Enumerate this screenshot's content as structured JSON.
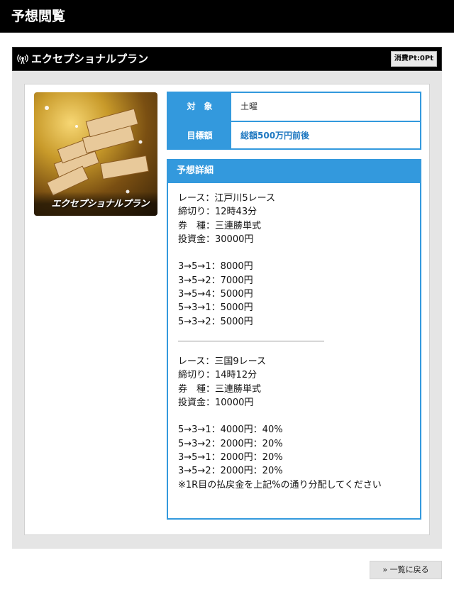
{
  "header": {
    "title": "予想閲覧"
  },
  "plan": {
    "title": "エクセプショナルプラン",
    "cost_badge": "消費Pt:0Pt",
    "image_label": "エクセプショナルプラン"
  },
  "info": {
    "rows": [
      {
        "key": "対　象",
        "value": "土曜"
      },
      {
        "key": "目標額",
        "value": "総額500万円前後"
      }
    ]
  },
  "detail": {
    "heading": "予想詳細",
    "race1": {
      "lines": [
        "レース：江戸川5レース",
        "締切り：12時43分",
        "券　種：三連勝単式",
        "投資金：30000円"
      ],
      "bets": [
        "3→5→1：8000円",
        "3→5→2：7000円",
        "3→5→4：5000円",
        "5→3→1：5000円",
        "5→3→2：5000円"
      ]
    },
    "race2": {
      "lines": [
        "レース：三国9レース",
        "締切り：14時12分",
        "券　種：三連勝単式",
        "投資金：10000円"
      ],
      "bets": [
        "5→3→1：4000円：40%",
        "5→3→2：2000円：20%",
        "3→5→1：2000円：20%",
        "3→5→2：2000円：20%"
      ],
      "note": "※1R目の払戻金を上記%の通り分配してください"
    }
  },
  "footer": {
    "back_label": "» 一覧に戻る"
  },
  "colors": {
    "accent": "#3399dd",
    "header_bg": "#000000",
    "panel_bg": "#e5e5e5",
    "highlight_text": "#1f78c1"
  }
}
